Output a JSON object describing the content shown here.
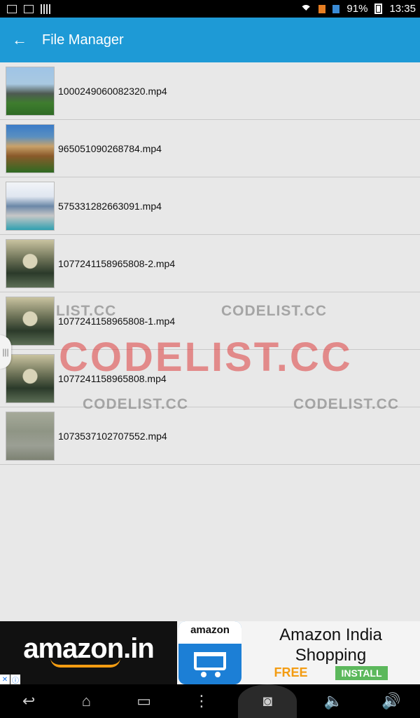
{
  "status_bar": {
    "battery": "91%",
    "time": "13:35"
  },
  "app_bar": {
    "title": "File Manager"
  },
  "files": [
    {
      "name": "1000249060082320.mp4"
    },
    {
      "name": "965051090268784.mp4"
    },
    {
      "name": "575331282663091.mp4"
    },
    {
      "name": "1077241158965808-2.mp4"
    },
    {
      "name": "1077241158965808-1.mp4"
    },
    {
      "name": "1077241158965808.mp4"
    },
    {
      "name": "1073537102707552.mp4"
    }
  ],
  "watermark": {
    "small": "CODELIST.CC",
    "big": "CODELIST.CC",
    "partial": "LIST.CC"
  },
  "ad": {
    "brand": "amazon.in",
    "icon_text": "amazon",
    "title_line1": "Amazon India",
    "title_line2": "Shopping",
    "free_label": "FREE",
    "install_label": "INSTALL"
  },
  "nav": {
    "back": "↩",
    "home": "⌂",
    "recents": "▭",
    "menu": "⋮",
    "camera": "◙",
    "vol_down": "🔈",
    "vol_up": "🔊"
  },
  "colors": {
    "app_bar": "#1e9ad6",
    "free": "#f39c12",
    "install": "#5cb85c",
    "watermark_big": "#dc3c3c"
  }
}
